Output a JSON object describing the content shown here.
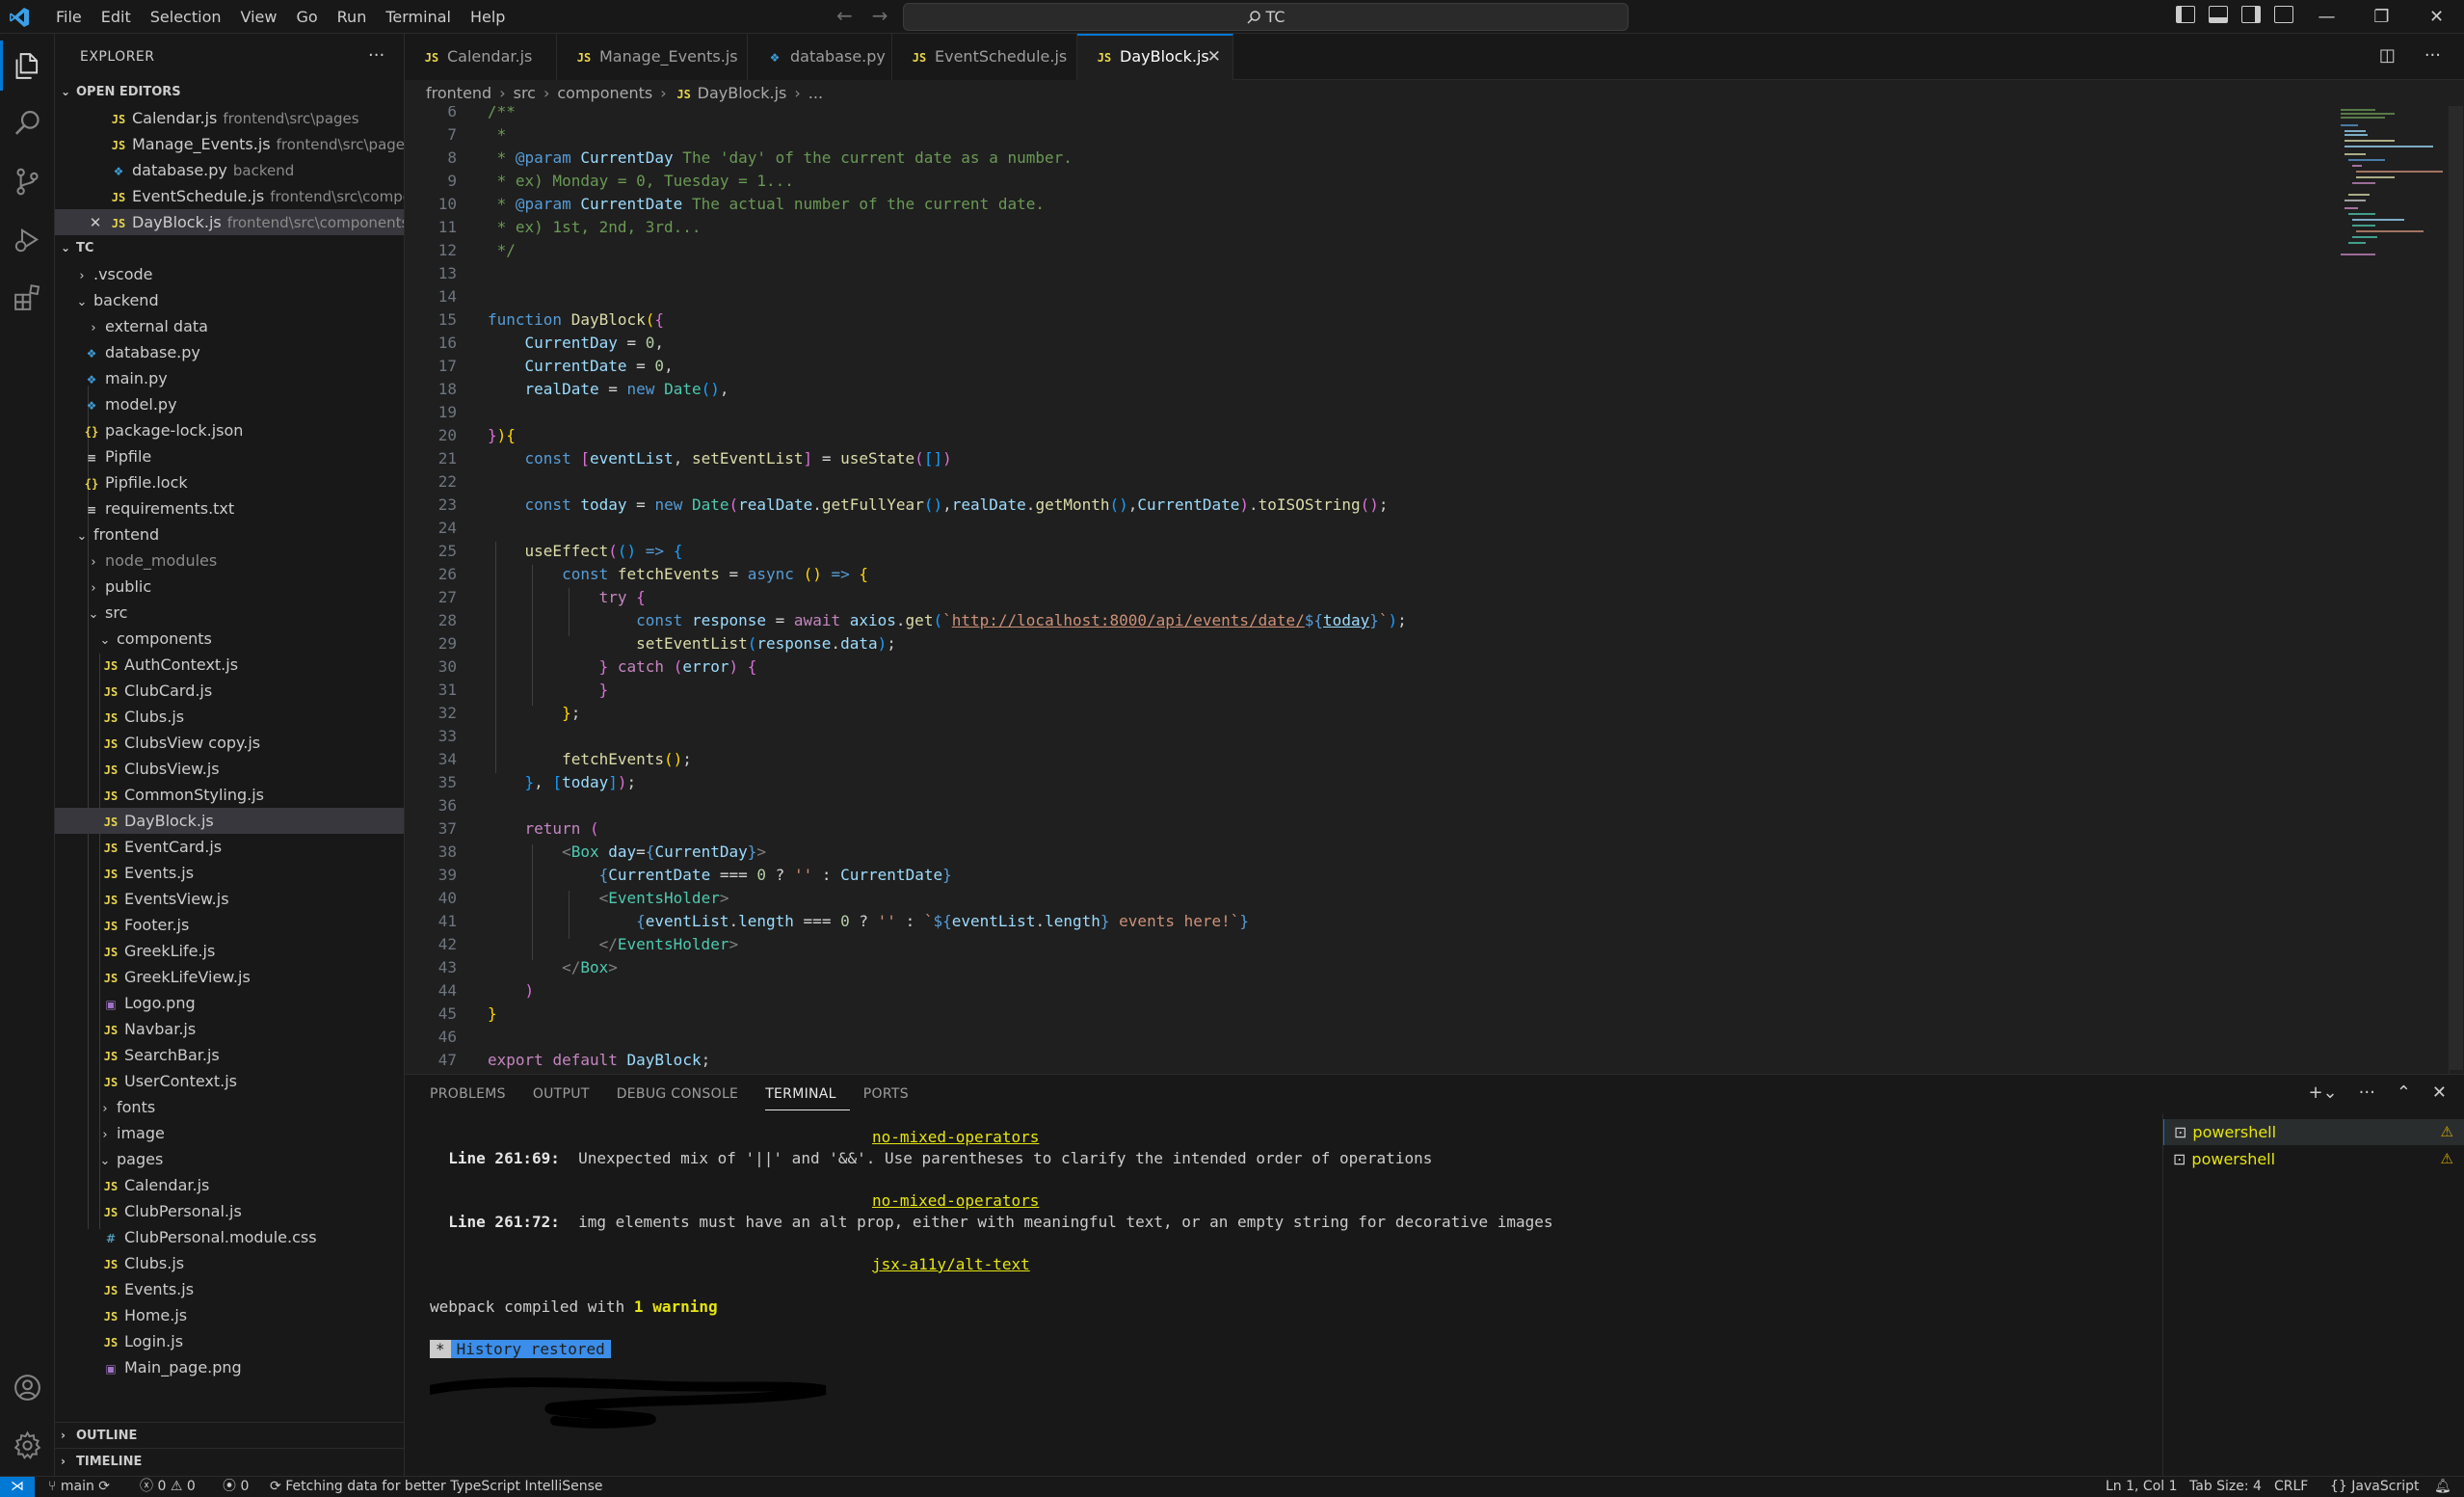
{
  "menu": [
    "File",
    "Edit",
    "Selection",
    "View",
    "Go",
    "Run",
    "Terminal",
    "Help"
  ],
  "search": {
    "text": "TC"
  },
  "explorer": {
    "title": "EXPLORER",
    "open_editors_label": "OPEN EDITORS",
    "open_editors": [
      {
        "name": "Calendar.js",
        "path": "frontend\\src\\pages"
      },
      {
        "name": "Manage_Events.js",
        "path": "frontend\\src\\pages"
      },
      {
        "name": "database.py",
        "path": "backend"
      },
      {
        "name": "EventSchedule.js",
        "path": "frontend\\src\\compon..."
      },
      {
        "name": "DayBlock.js",
        "path": "frontend\\src\\components"
      }
    ],
    "workspace_label": "TC",
    "tree": [
      ".vscode",
      "backend",
      "external data",
      "database.py",
      "main.py",
      "model.py",
      "package-lock.json",
      "Pipfile",
      "Pipfile.lock",
      "requirements.txt",
      "frontend",
      "node_modules",
      "public",
      "src",
      "components",
      "AuthContext.js",
      "ClubCard.js",
      "Clubs.js",
      "ClubsView copy.js",
      "ClubsView.js",
      "CommonStyling.js",
      "DayBlock.js",
      "EventCard.js",
      "Events.js",
      "EventsView.js",
      "Footer.js",
      "GreekLife.js",
      "GreekLifeView.js",
      "Logo.png",
      "Navbar.js",
      "SearchBar.js",
      "UserContext.js",
      "fonts",
      "image",
      "pages",
      "Calendar.js",
      "ClubPersonal.js",
      "ClubPersonal.module.css",
      "Clubs.js",
      "Events.js",
      "Home.js",
      "Login.js",
      "Main_page.png"
    ],
    "outline_label": "OUTLINE",
    "timeline_label": "TIMELINE"
  },
  "tabs": [
    "Calendar.js",
    "Manage_Events.js",
    "database.py",
    "EventSchedule.js",
    "DayBlock.js"
  ],
  "breadcrumb": [
    "frontend",
    "src",
    "components",
    "DayBlock.js",
    "..."
  ],
  "editor": {
    "line_numbers": [
      "6",
      "7",
      "8",
      "9",
      "10",
      "11",
      "12",
      "13",
      "14",
      "15",
      "16",
      "17",
      "18",
      "19",
      "20",
      "21",
      "22",
      "23",
      "24",
      "25",
      "26",
      "27",
      "28",
      "29",
      "30",
      "31",
      "32",
      "33",
      "34",
      "35",
      "36",
      "37",
      "38",
      "39",
      "40",
      "41",
      "42",
      "43",
      "44",
      "45",
      "46",
      "47"
    ],
    "url": "http://localhost:8000/api/events/date/"
  },
  "panel": {
    "tabs": [
      "PROBLEMS",
      "OUTPUT",
      "DEBUG CONSOLE",
      "TERMINAL",
      "PORTS"
    ],
    "terminal": {
      "rule1": "no-mixed-operators",
      "line1_loc": "Line 261:69:",
      "line1_msg": "Unexpected mix of '||' and '&&'. Use parentheses to clarify the intended order of operations",
      "rule2": "no-mixed-operators",
      "line2_loc": "Line 261:72:",
      "line2_msg": "img elements must have an alt prop, either with meaningful text, or an empty string for decorative images",
      "rule3": "jsx-a11y/alt-text",
      "compiled_prefix": "webpack compiled with ",
      "compiled_warn": "1 warning",
      "history_mark": "*",
      "history": "History restored"
    },
    "terminals": [
      "powershell",
      "powershell"
    ]
  },
  "status": {
    "branch": "main",
    "errors": "0",
    "warnings": "0",
    "ports": "0",
    "message": "Fetching data for better TypeScript IntelliSense",
    "position": "Ln 1, Col 1",
    "tab_size": "Tab Size: 4",
    "eol": "CRLF",
    "language": "JavaScript"
  },
  "colors": {
    "accent": "#0078d4",
    "editor_bg": "#1f1f1f",
    "sidebar_bg": "#181818"
  }
}
